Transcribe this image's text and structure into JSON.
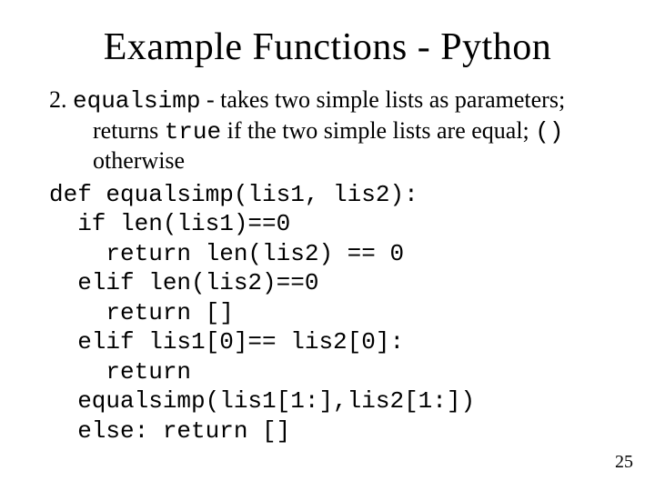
{
  "title": "Example Functions - Python",
  "item_number": "2.",
  "func_name": "equalsimp",
  "desc_part1": " - takes two simple lists as parameters;",
  "desc_line2a": "returns ",
  "true_kw": "true",
  "desc_line2b": " if the two simple lists are equal; ",
  "empty_tuple": "()",
  "desc_line3": "otherwise",
  "code": {
    "l1": "def equalsimp(lis1, lis2):",
    "l2": "  if len(lis1)==0",
    "l3": "    return len(lis2) == 0",
    "l4": "  elif len(lis2)==0",
    "l5": "    return []",
    "l6": "  elif lis1[0]== lis2[0]:",
    "l7": "    return",
    "l8": "  equalsimp(lis1[1:],lis2[1:])",
    "l9": "  else: return []"
  },
  "page_number": "25"
}
